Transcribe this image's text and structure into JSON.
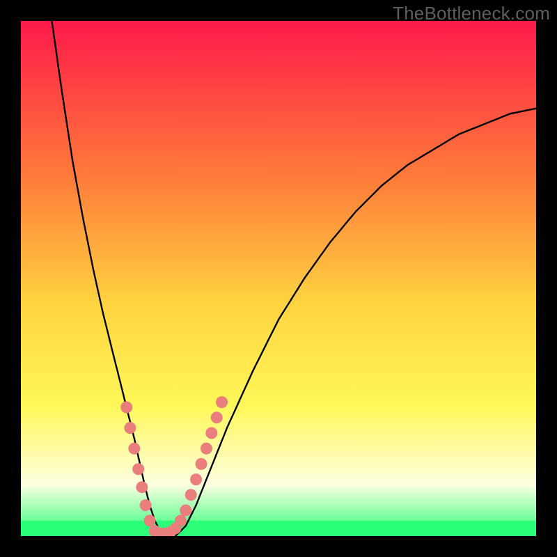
{
  "watermark": "TheBottleneck.com",
  "colors": {
    "frame": "#000000",
    "grad_top": "#ff1a4b",
    "grad_mid_upper": "#ff7a3a",
    "grad_mid": "#ffd440",
    "grad_mid_lower": "#fff85a",
    "grad_pale": "#fdffe0",
    "grad_bottom": "#2bff7a",
    "curve": "#000000",
    "dots": "#e97e7c",
    "watermark": "#5f5f5f"
  },
  "chart_data": {
    "type": "line",
    "title": "",
    "xlabel": "",
    "ylabel": "",
    "xlim": [
      0,
      100
    ],
    "ylim": [
      0,
      100
    ],
    "series": [
      {
        "name": "bottleneck-curve",
        "x": [
          6,
          8,
          10,
          12,
          14,
          16,
          18,
          20,
          22,
          24,
          25,
          26,
          27,
          28,
          30,
          32,
          34,
          36,
          40,
          45,
          50,
          55,
          60,
          65,
          70,
          75,
          80,
          85,
          90,
          95,
          100
        ],
        "y": [
          100,
          86,
          73,
          62,
          52,
          43,
          35,
          27,
          19,
          10,
          6,
          3,
          1,
          0,
          0,
          2,
          6,
          11,
          21,
          32,
          42,
          50,
          57,
          63,
          68,
          72,
          75,
          78,
          80,
          82,
          83
        ]
      }
    ],
    "highlight_points": {
      "name": "dotted-segment",
      "points": [
        {
          "x": 20.5,
          "y": 25
        },
        {
          "x": 21.2,
          "y": 21
        },
        {
          "x": 22.0,
          "y": 17
        },
        {
          "x": 22.8,
          "y": 13
        },
        {
          "x": 23.5,
          "y": 9.5
        },
        {
          "x": 24.2,
          "y": 6
        },
        {
          "x": 25.0,
          "y": 3
        },
        {
          "x": 26.0,
          "y": 1
        },
        {
          "x": 27.0,
          "y": 0.5
        },
        {
          "x": 28.0,
          "y": 0.5
        },
        {
          "x": 29.0,
          "y": 0.8
        },
        {
          "x": 30.0,
          "y": 1.5
        },
        {
          "x": 31.0,
          "y": 3
        },
        {
          "x": 32.0,
          "y": 5
        },
        {
          "x": 33.0,
          "y": 8
        },
        {
          "x": 34.0,
          "y": 11
        },
        {
          "x": 35.0,
          "y": 14
        },
        {
          "x": 36.0,
          "y": 17
        },
        {
          "x": 37.0,
          "y": 20
        },
        {
          "x": 38.0,
          "y": 23
        },
        {
          "x": 39.0,
          "y": 26
        }
      ]
    },
    "green_band": {
      "y0": 0,
      "y1": 3
    }
  }
}
